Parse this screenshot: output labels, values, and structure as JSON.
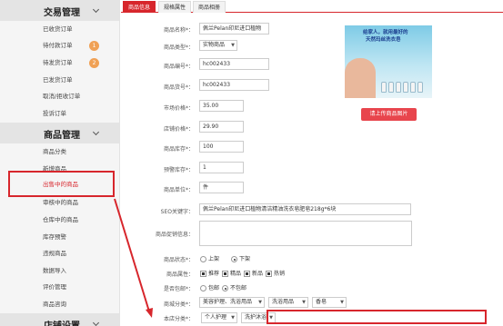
{
  "sidebar": {
    "sections": [
      {
        "title": "交易管理",
        "items": [
          {
            "label": "已收货订单"
          },
          {
            "label": "待付款订单",
            "badge": "1"
          },
          {
            "label": "待发货订单",
            "badge": "2"
          },
          {
            "label": "已发货订单"
          },
          {
            "label": "取消/拒收订单"
          },
          {
            "label": "投诉订单"
          }
        ]
      },
      {
        "title": "商品管理",
        "items": [
          {
            "label": "商品分类"
          },
          {
            "label": "新增商品"
          },
          {
            "label": "出售中的商品",
            "active": true
          },
          {
            "label": "审核中的商品"
          },
          {
            "label": "仓库中的商品"
          },
          {
            "label": "库存预警"
          },
          {
            "label": "违规商品"
          },
          {
            "label": "数据导入"
          },
          {
            "label": "评价管理"
          },
          {
            "label": "商品咨询"
          }
        ]
      },
      {
        "title": "店铺设置",
        "items": []
      }
    ]
  },
  "tabs": [
    {
      "label": "商品信息",
      "active": true
    },
    {
      "label": "规格属性"
    },
    {
      "label": "商品相册"
    }
  ],
  "form": {
    "name": {
      "label": "商品名称*：",
      "value": "佩兰Pelan印尼进口植物"
    },
    "type": {
      "label": "商品类型*：",
      "value": "实物商品"
    },
    "code": {
      "label": "商品编号*：",
      "value": "hc002433"
    },
    "sku": {
      "label": "商品货号*：",
      "value": "hc002433"
    },
    "market_price": {
      "label": "市场价格*：",
      "value": "35.00"
    },
    "shop_price": {
      "label": "店铺价格*：",
      "value": "29.90"
    },
    "stock": {
      "label": "商品库存*：",
      "value": "100"
    },
    "warn_stock": {
      "label": "预警库存*：",
      "value": "1"
    },
    "unit": {
      "label": "商品单位*：",
      "value": "件"
    },
    "seo": {
      "label": "SEO关键字：",
      "value": "佩兰Pelan印尼进口植物清洁精油洗衣皂肥皂218g*6块"
    },
    "promo": {
      "label": "商品促销信息："
    },
    "status": {
      "label": "商品状态*：",
      "options": [
        "上架",
        "下架"
      ],
      "selected": 1
    },
    "attrs": {
      "label": "商品属性：",
      "options": [
        "推荐",
        "精品",
        "新品",
        "热销"
      ]
    },
    "shipping": {
      "label": "是否包邮*：",
      "options": [
        "包邮",
        "不包邮"
      ],
      "selected": 1
    },
    "mall_category": {
      "label": "商城分类*：",
      "values": [
        "美容护理、洗浴用品",
        "洗浴用品",
        "香皂"
      ]
    },
    "shop_category": {
      "label": "本店分类*：",
      "values": [
        "个人护理",
        "洗护沐浴"
      ]
    }
  },
  "product_image": {
    "line1": "给家人，就用最好的",
    "line2": "天然玛丝洗衣皂",
    "icon": "product-photo"
  },
  "upload_button": {
    "label": "请上传商品图片"
  },
  "colors": {
    "accent": "#d7262c",
    "badge": "#f0a155",
    "upload": "#e8454d"
  }
}
